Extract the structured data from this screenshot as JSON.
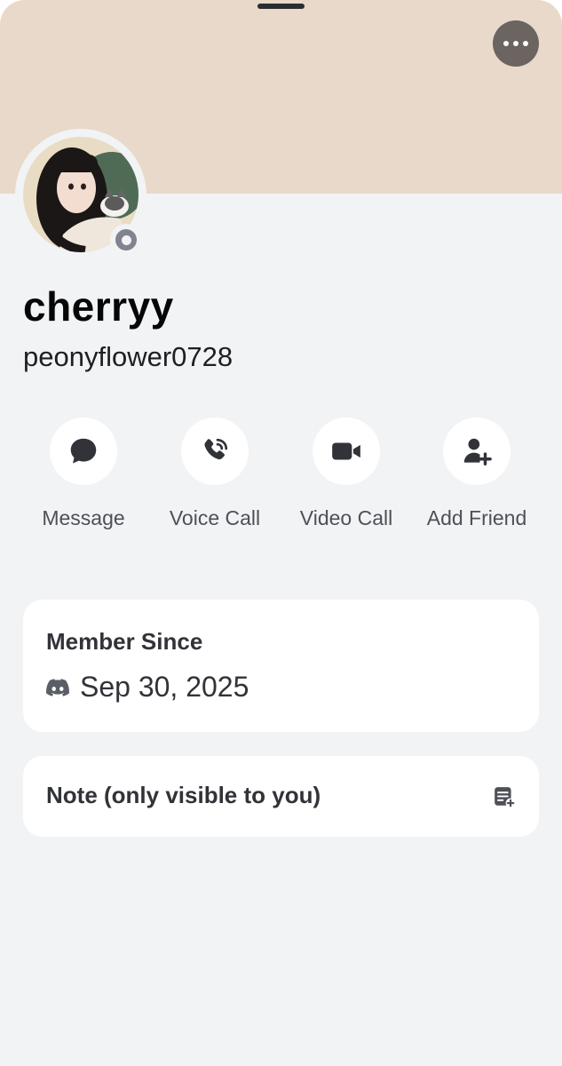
{
  "profile": {
    "display_name": "cherryy",
    "username": "peonyflower0728",
    "status": "offline",
    "banner_color": "#e8d9ca"
  },
  "actions": [
    {
      "label": "Message",
      "icon": "chat-bubble-icon"
    },
    {
      "label": "Voice Call",
      "icon": "phone-icon"
    },
    {
      "label": "Video Call",
      "icon": "video-camera-icon"
    },
    {
      "label": "Add Friend",
      "icon": "add-friend-icon"
    }
  ],
  "member_since": {
    "title": "Member Since",
    "date": "Sep 30, 2025",
    "icon": "discord-logo-icon"
  },
  "note": {
    "title": "Note (only visible to you)",
    "icon": "note-add-icon"
  },
  "header": {
    "more_icon": "more-options-icon"
  }
}
